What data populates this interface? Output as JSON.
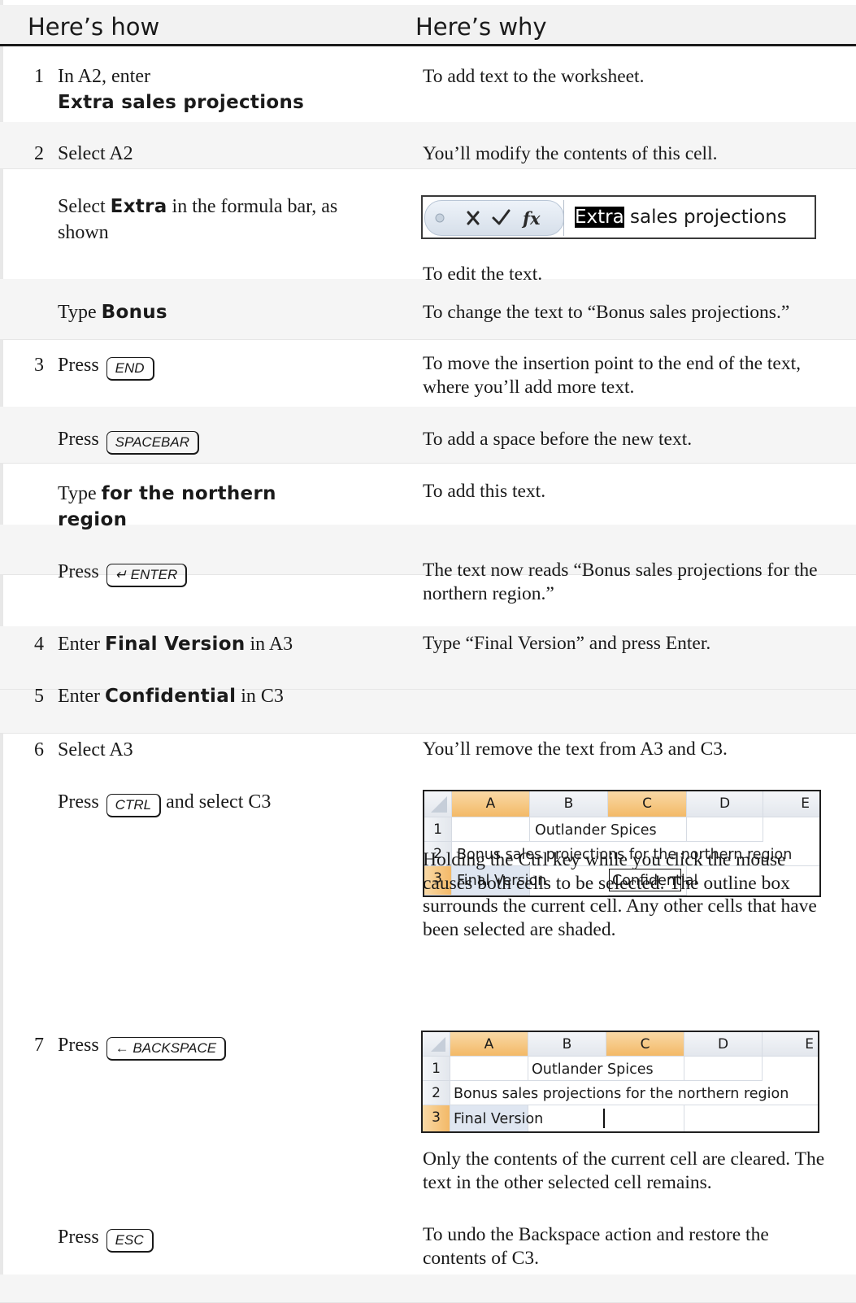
{
  "header": {
    "how": "Here’s how",
    "why": "Here’s why"
  },
  "steps": {
    "s1": {
      "num": "1",
      "how_pre": "In A2, enter",
      "how_bold": "Extra sales projections",
      "why": "To add text to the worksheet."
    },
    "s2a": {
      "num": "2",
      "how": "Select A2",
      "why": "You’ll modify the contents of this cell."
    },
    "s2b": {
      "how_pre": "Select ",
      "how_bold": "Extra",
      "how_post": " in the formula bar, as shown",
      "why": "To edit the text."
    },
    "s2c": {
      "how_pre": "Type ",
      "how_bold": "Bonus",
      "why": "To change the text to “Bonus sales projections.”"
    },
    "s3a": {
      "num": "3",
      "how_pre": "Press ",
      "key": "END",
      "why": "To move the insertion point to the end of the text, where you’ll add more text."
    },
    "s3b": {
      "how_pre": "Press ",
      "key": "SPACEBAR",
      "why": "To add a space before the new text."
    },
    "s3c": {
      "how_pre": "Type ",
      "how_bold": "for the northern region",
      "why": "To add this text."
    },
    "s3d": {
      "how_pre": "Press ",
      "key": "↵ ENTER",
      "why": "The text now reads “Bonus sales projections for the northern region.”"
    },
    "s4": {
      "num": "4",
      "how_pre": "Enter ",
      "how_bold": "Final Version",
      "how_post": " in A3",
      "why": "Type “Final Version” and press Enter."
    },
    "s5": {
      "num": "5",
      "how_pre": "Enter ",
      "how_bold": "Confidential",
      "how_post": " in C3"
    },
    "s6a": {
      "num": "6",
      "how": "Select A3",
      "why": "You’ll remove the text from A3 and C3."
    },
    "s6b": {
      "how_pre": "Press ",
      "key": "CTRL",
      "how_post": " and select C3",
      "why": "Holding the Ctrl key while you click the mouse causes both cells to be selected. The outline box surrounds the current cell. Any other cells that have been selected are shaded."
    },
    "s7a": {
      "num": "7",
      "how_pre": "Press ",
      "key": "← BACKSPACE",
      "why": "Only the contents of the current cell are cleared. The text in the other selected cell remains."
    },
    "s7b": {
      "how_pre": "Press ",
      "key": "ESC",
      "why": "To undo the Backspace action and restore the contents of C3."
    }
  },
  "formula_bar": {
    "selected": "Extra",
    "rest": " sales projections",
    "icons": [
      "name-box-icon",
      "cancel-x-icon",
      "enter-check-icon",
      "function-fx-icon"
    ]
  },
  "grid_columns": [
    "A",
    "B",
    "C",
    "D",
    "E"
  ],
  "grid1": {
    "rows": [
      {
        "num": "1",
        "text": "Outlander Spices"
      },
      {
        "num": "2",
        "text": "Bonus sales projections for the northern region"
      },
      {
        "num": "3",
        "a3": "Final Version",
        "c3": "Confidential"
      }
    ]
  },
  "grid2": {
    "rows": [
      {
        "num": "1",
        "text": "Outlander Spices"
      },
      {
        "num": "2",
        "text": "Bonus sales projections for the northern region"
      },
      {
        "num": "3",
        "a3": "Final Version"
      }
    ]
  },
  "colors": {
    "header_rule": "#1a1a1a",
    "selected_header": "#f3b967",
    "row_band": "#f5f5f5"
  }
}
